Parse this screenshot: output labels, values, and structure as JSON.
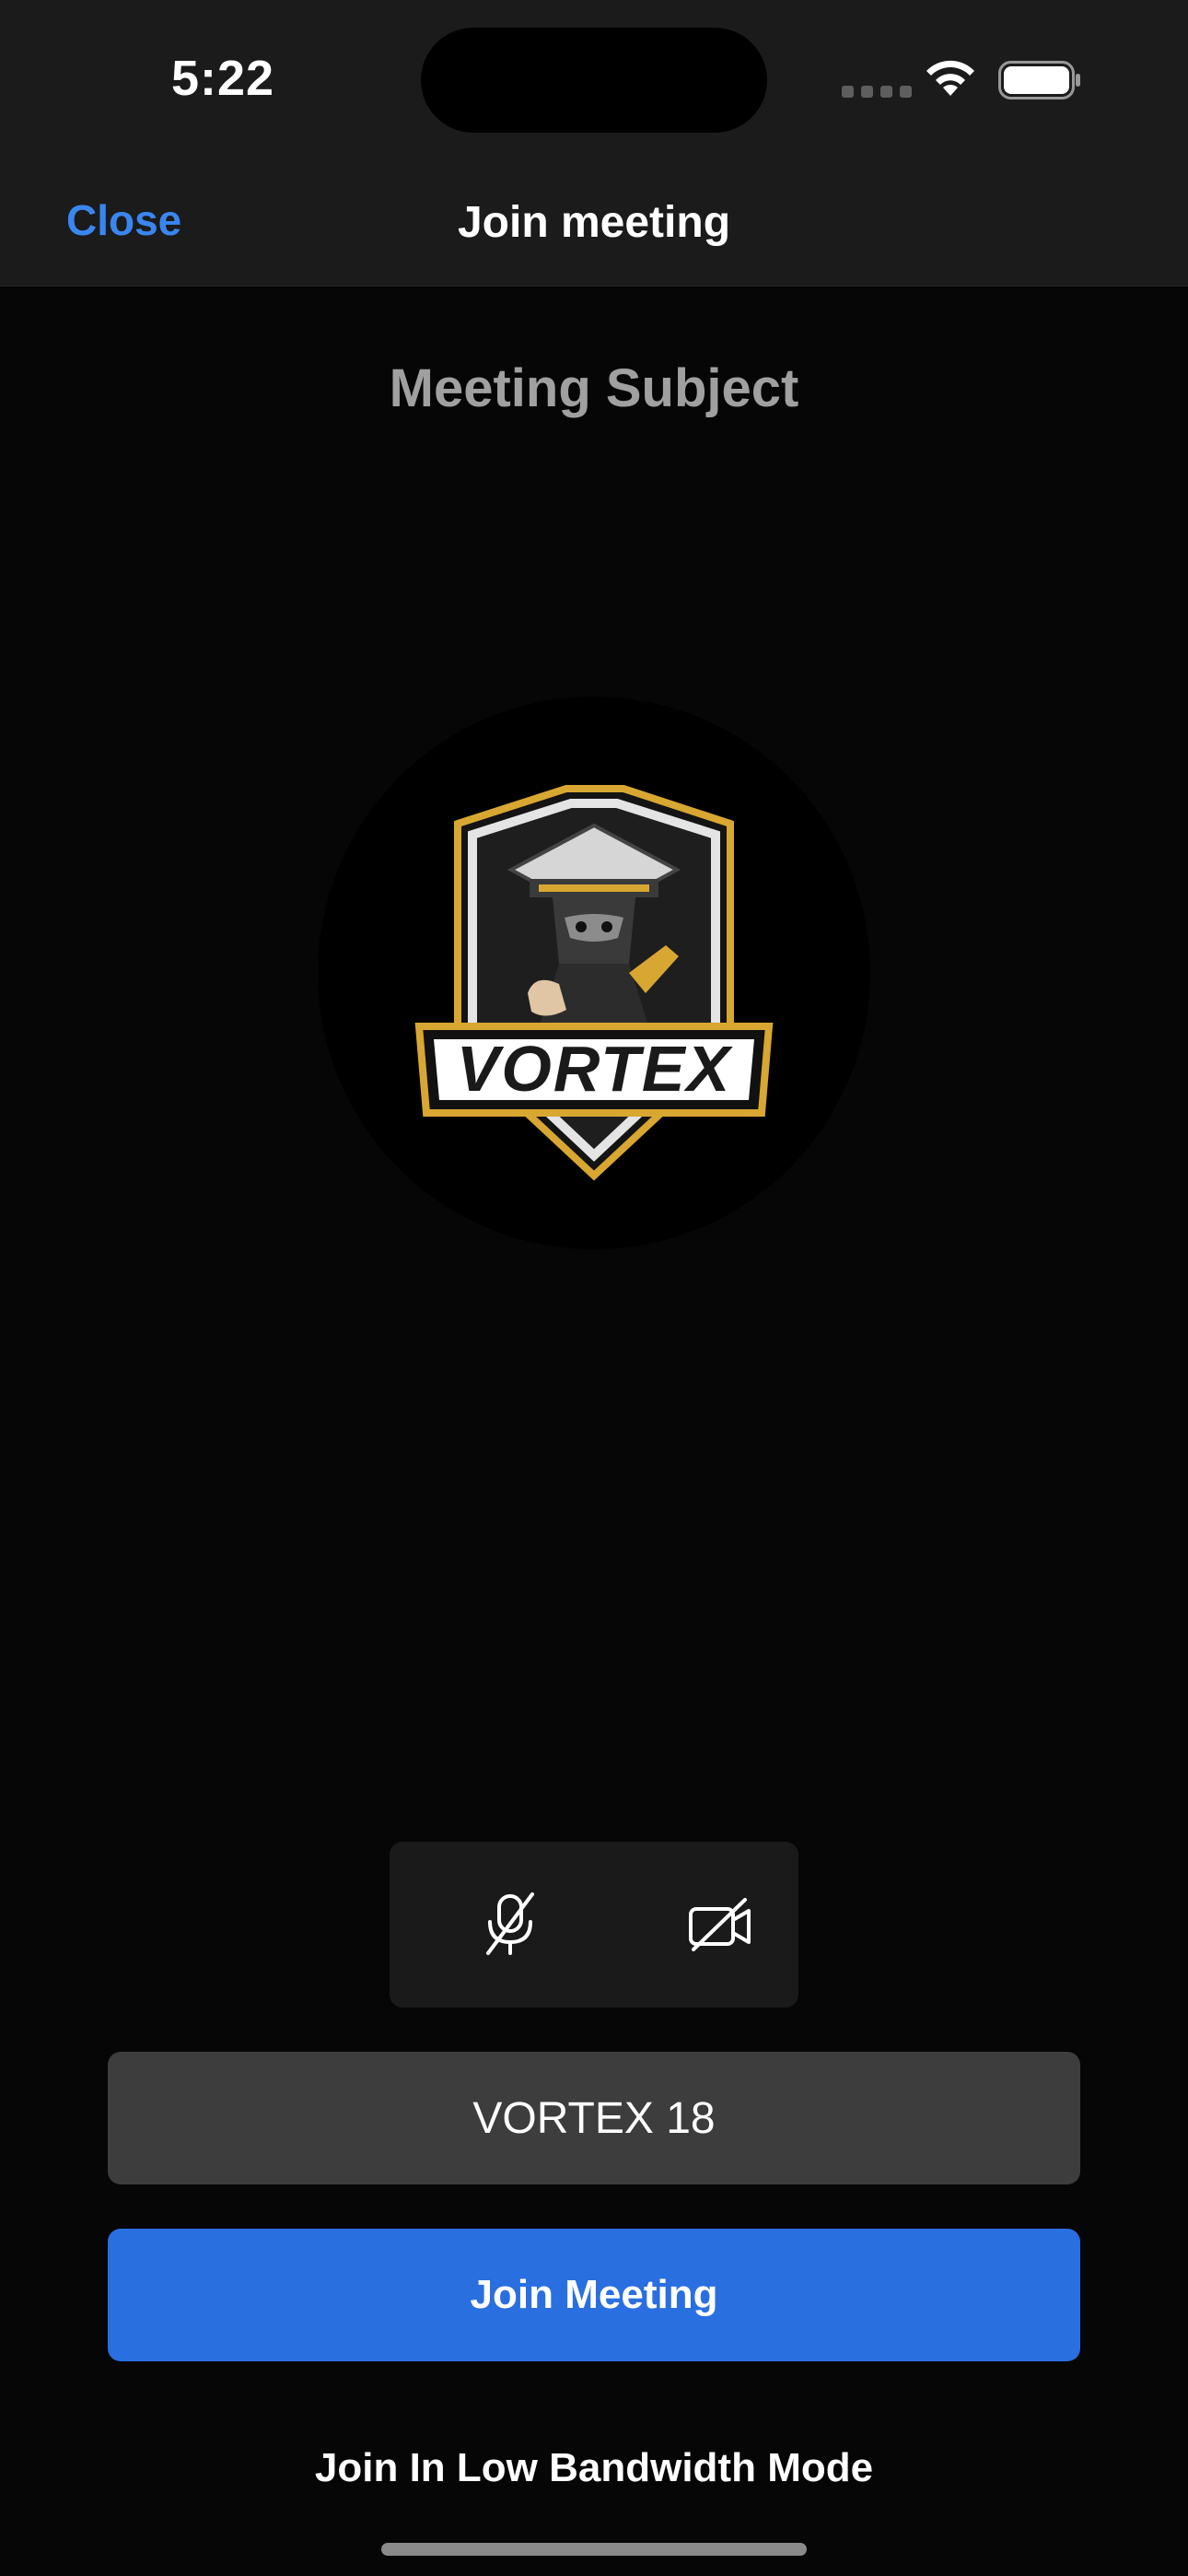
{
  "status_bar": {
    "time": "5:22",
    "icons": [
      "signal-dots-icon",
      "wifi-icon",
      "battery-icon"
    ]
  },
  "nav": {
    "close_label": "Close",
    "title": "Join meeting"
  },
  "meeting": {
    "subject": "Meeting Subject",
    "avatar_logo_text": "VORTEX"
  },
  "controls": {
    "mic_icon": "mic-off-icon",
    "camera_icon": "camera-off-icon"
  },
  "name_field": {
    "value": "VORTEX 18"
  },
  "join_button": {
    "label": "Join Meeting"
  },
  "low_bandwidth": {
    "label": "Join In Low Bandwidth Mode"
  },
  "colors": {
    "accent": "#2a6fe0",
    "link": "#3a86f0",
    "bar_background": "#1b1b1b",
    "page_background": "#060606",
    "field_background": "#3d3d3d",
    "logo_gold": "#d8a732"
  }
}
